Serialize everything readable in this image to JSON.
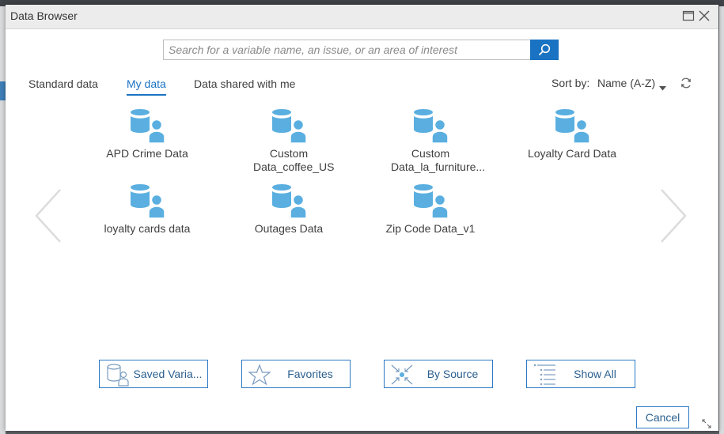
{
  "window": {
    "title": "Data Browser"
  },
  "search": {
    "placeholder": "Search for a variable name, an issue, or an area of interest",
    "value": ""
  },
  "tabs": [
    {
      "label": "Standard data",
      "active": false
    },
    {
      "label": "My data",
      "active": true
    },
    {
      "label": "Data shared with me",
      "active": false
    }
  ],
  "sort": {
    "label": "Sort by:",
    "value": "Name (A-Z)"
  },
  "items": [
    {
      "label": "APD Crime Data",
      "icon": "database-user-icon"
    },
    {
      "label": "Custom Data_coffee_US",
      "icon": "database-user-icon"
    },
    {
      "label": "Custom Data_la_furniture...",
      "icon": "database-user-icon"
    },
    {
      "label": "Loyalty Card Data",
      "icon": "database-user-icon"
    },
    {
      "label": "loyalty cards data",
      "icon": "database-user-icon"
    },
    {
      "label": "Outages Data",
      "icon": "database-user-icon"
    },
    {
      "label": "Zip Code Data_v1",
      "icon": "database-user-icon"
    }
  ],
  "bottom_buttons": [
    {
      "label": "Saved Varia...",
      "icon": "saved-variables-icon"
    },
    {
      "label": "Favorites",
      "icon": "star-icon"
    },
    {
      "label": "By Source",
      "icon": "by-source-icon"
    },
    {
      "label": "Show All",
      "icon": "list-icon"
    }
  ],
  "footer": {
    "cancel_label": "Cancel"
  },
  "colors": {
    "accent": "#1a73c2",
    "icon_blue": "#5aafe0",
    "button_border": "#2b78c4"
  }
}
